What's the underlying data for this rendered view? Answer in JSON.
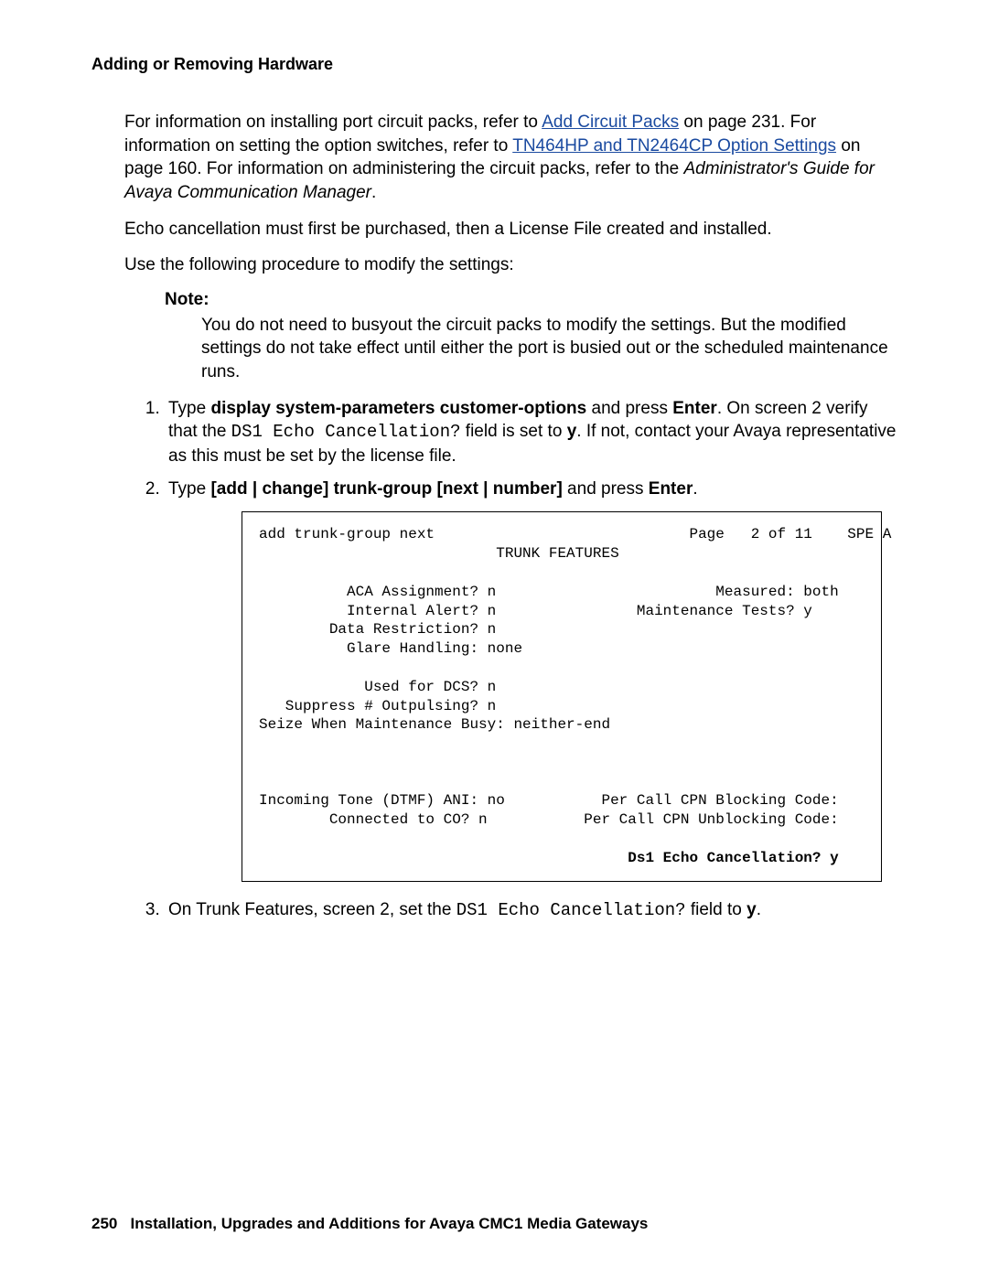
{
  "header": {
    "title": "Adding or Removing Hardware"
  },
  "paragraphs": {
    "p1_a": "For information on installing port circuit packs, refer to ",
    "p1_link1": "Add Circuit Packs",
    "p1_b": " on page 231. For information on setting the option switches, refer to ",
    "p1_link2": "TN464HP and TN2464CP Option Settings",
    "p1_c": " on page 160. For information on administering the circuit packs, refer to the ",
    "p1_italic": "Administrator's Guide for Avaya Communication Manager",
    "p1_d": ".",
    "p2": "Echo cancellation must first be purchased, then a License File created and installed.",
    "p3": "Use the following procedure to modify the settings:"
  },
  "note": {
    "label": "Note:",
    "text": "You do not need to busyout the circuit packs to modify the settings. But the modified settings do not take effect until either the port is busied out or the scheduled maintenance runs."
  },
  "steps": {
    "s1_a": "Type ",
    "s1_bold": "display system-parameters customer-options",
    "s1_b": " and press ",
    "s1_bold2": "Enter",
    "s1_c": ". On screen 2 verify that the ",
    "s1_mono": "DS1 Echo Cancellation?",
    "s1_d": " field is set to ",
    "s1_bold3": "y",
    "s1_e": ". If not, contact your Avaya representative as this must be set by the license file.",
    "s2_a": "Type ",
    "s2_bold": "[add | change] trunk-group [next | number]",
    "s2_b": " and press ",
    "s2_bold2": "Enter",
    "s2_c": ".",
    "s3_a": "On Trunk Features, screen 2, set the ",
    "s3_mono": "DS1 Echo Cancellation?",
    "s3_b": " field to ",
    "s3_bold": "y",
    "s3_c": "."
  },
  "terminal": {
    "line1": "add trunk-group next                             Page   2 of 11    SPE A",
    "line2": "                           TRUNK FEATURES",
    "blank": " ",
    "line3": "          ACA Assignment? n                         Measured: both",
    "line4": "          Internal Alert? n                Maintenance Tests? y",
    "line5": "        Data Restriction? n",
    "line6": "          Glare Handling: none",
    "line7": "            Used for DCS? n",
    "line8": "   Suppress # Outpulsing? n",
    "line9": "Seize When Maintenance Busy: neither-end",
    "line10": "Incoming Tone (DTMF) ANI: no           Per Call CPN Blocking Code:",
    "line11": "        Connected to CO? n           Per Call CPN Unblocking Code:",
    "line12": "                                          Ds1 Echo Cancellation? y"
  },
  "footer": {
    "page": "250",
    "title": "Installation, Upgrades and Additions for Avaya CMC1 Media Gateways"
  }
}
